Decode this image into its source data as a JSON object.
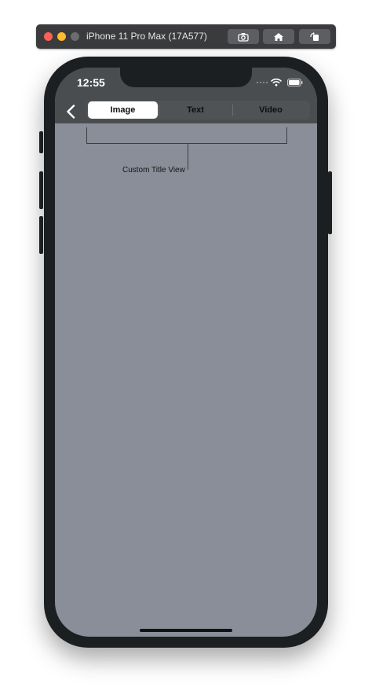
{
  "simulator": {
    "title": "iPhone 11 Pro Max (17A577)",
    "buttons": [
      {
        "icon": "camera-icon"
      },
      {
        "icon": "home-icon"
      },
      {
        "icon": "rotate-icon"
      }
    ]
  },
  "status_bar": {
    "time": "12:55",
    "icons": [
      "cellular-signal-icon",
      "wifi-icon",
      "battery-icon"
    ]
  },
  "navigation": {
    "back_icon": "chevron-left-icon",
    "segments": [
      {
        "label": "Image",
        "selected": true
      },
      {
        "label": "Text",
        "selected": false
      },
      {
        "label": "Video",
        "selected": false
      }
    ]
  },
  "annotation": {
    "label": "Custom Title View"
  },
  "colors": {
    "screen_background": "#8a8e98",
    "nav_bar": "#4a4d4f",
    "phone_frame": "#1c1f21",
    "selected_segment": "#ffffff"
  }
}
